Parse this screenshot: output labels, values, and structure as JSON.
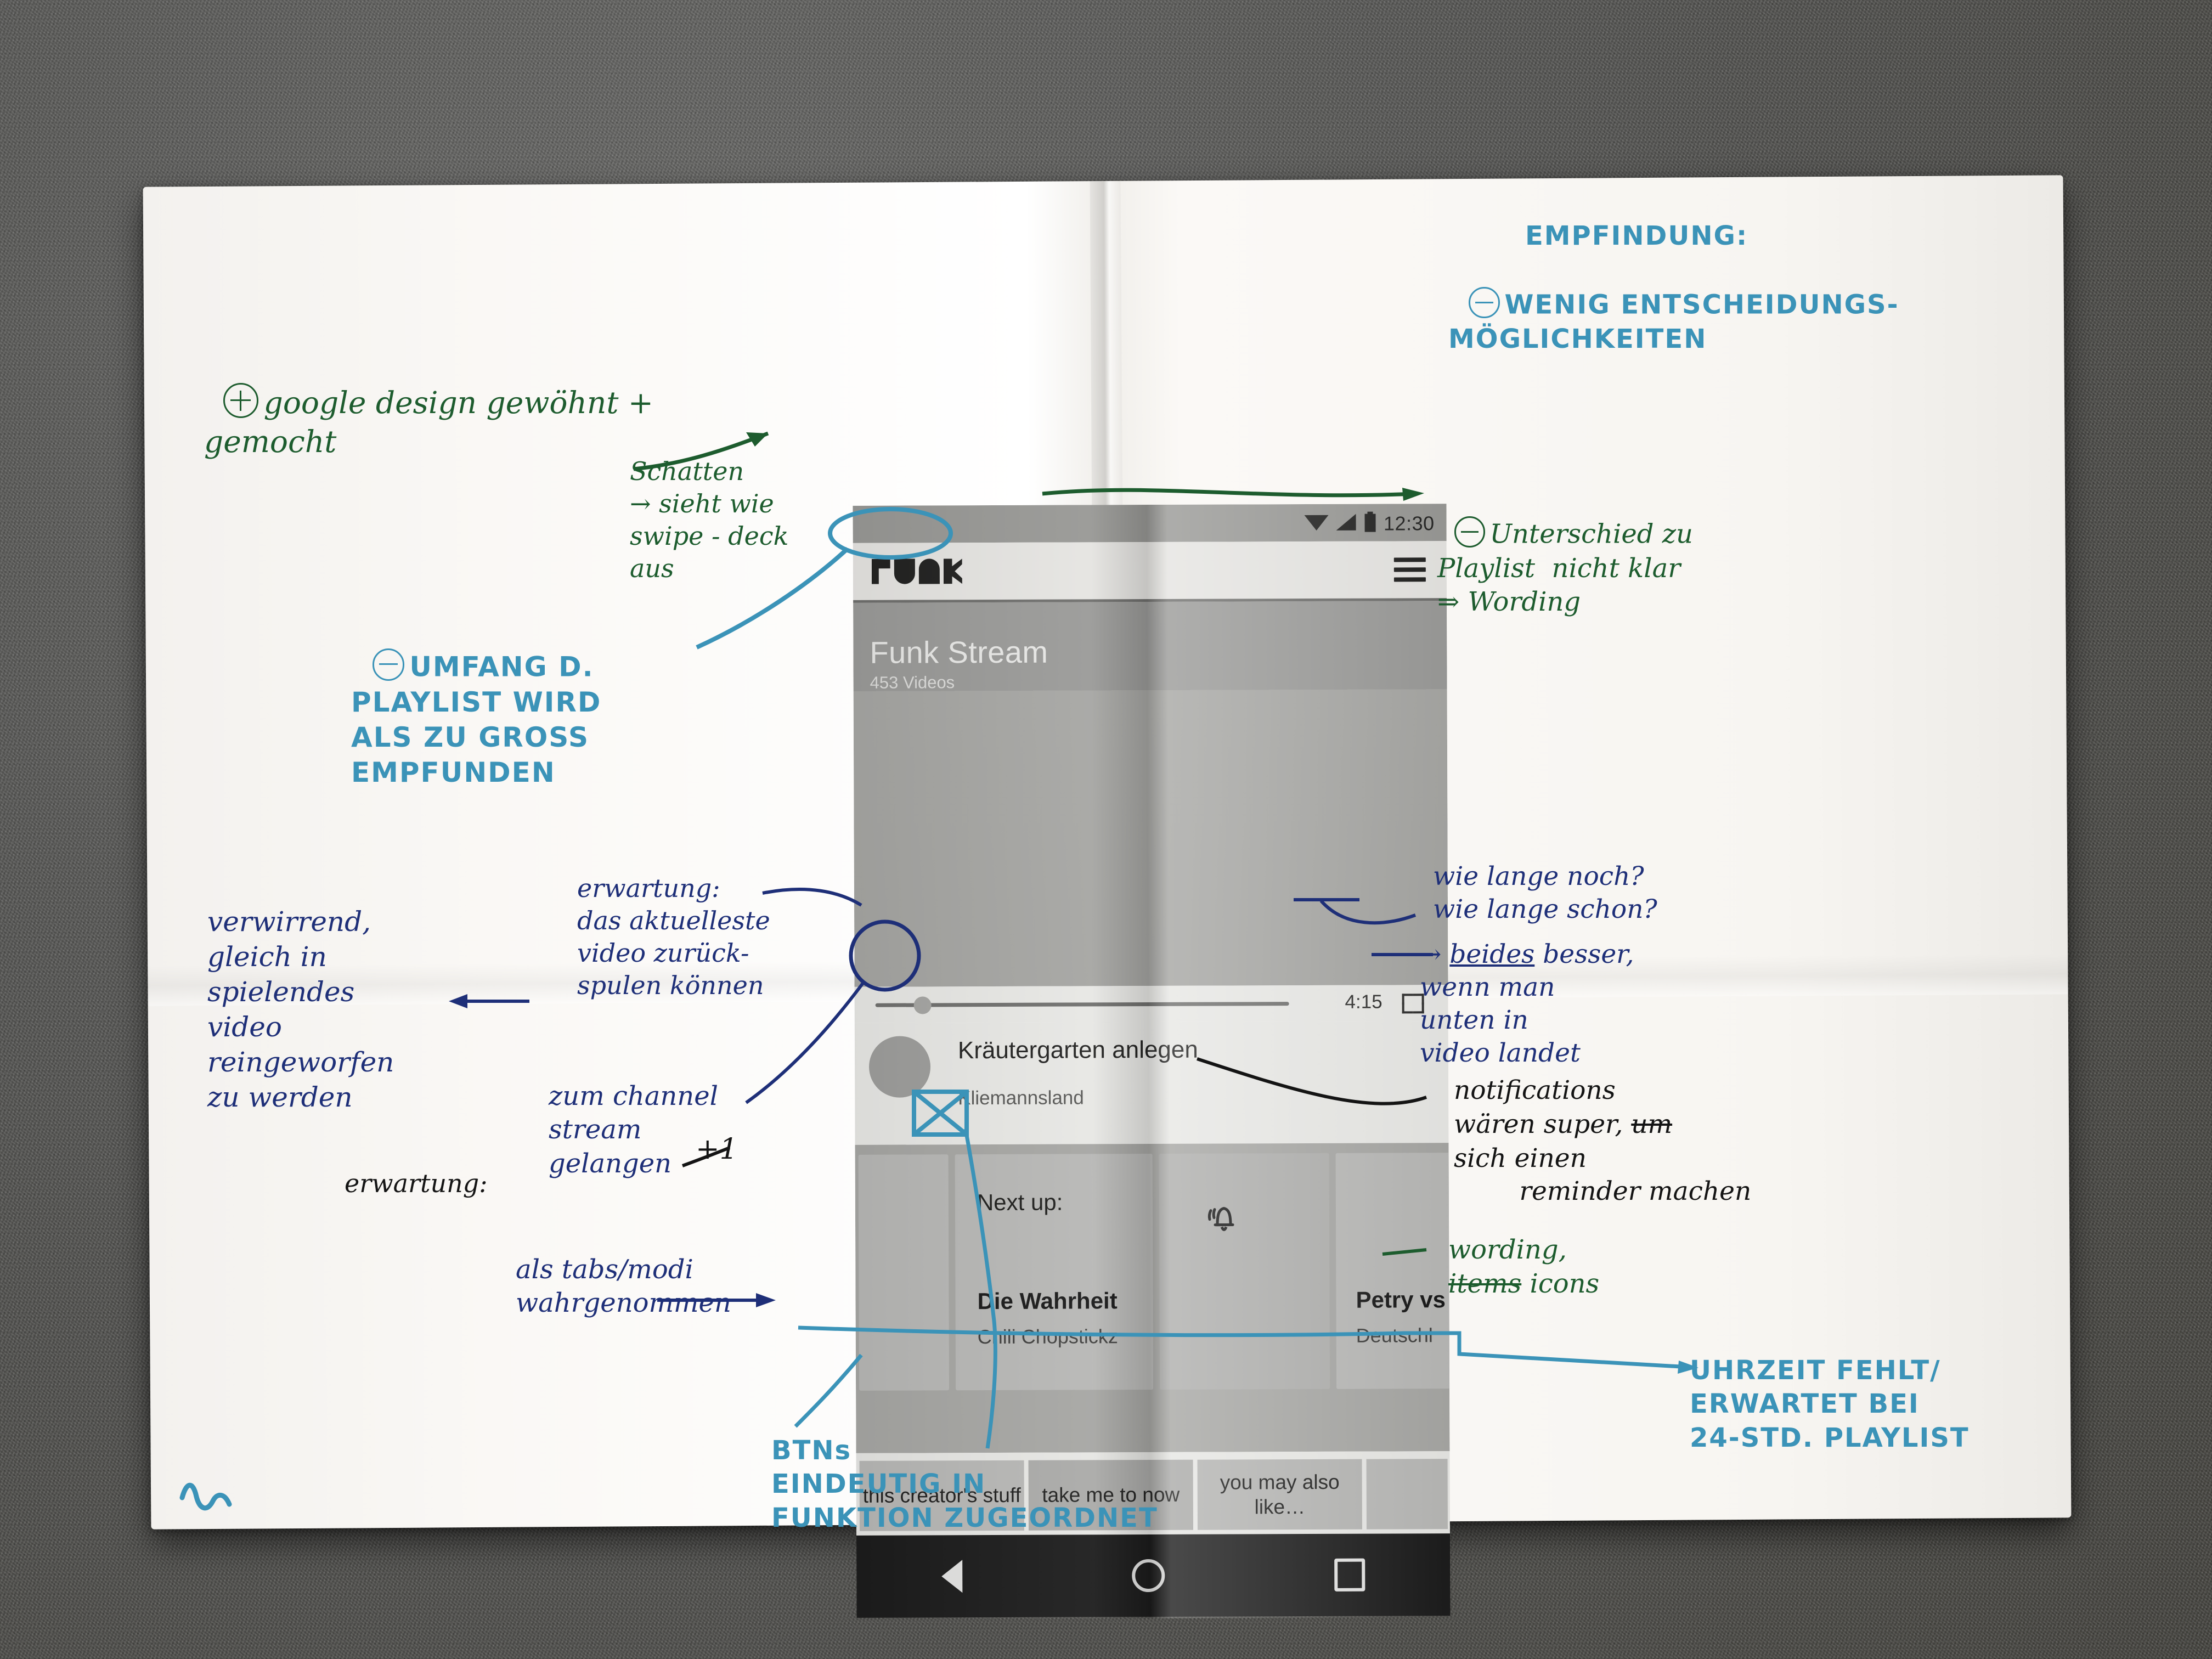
{
  "scene": {
    "medium": "photo of a folded A3 paper printout on grey carpet",
    "paper_note_bottom_left": "m"
  },
  "phone": {
    "statusbar": {
      "time": "12:30",
      "icons": [
        "wifi-icon",
        "signal-icon",
        "battery-icon"
      ]
    },
    "appbar": {
      "logo": "FUNK",
      "menu": "hamburger-menu-icon"
    },
    "hero": {
      "title": "Funk Stream",
      "subtitle": "453 Videos"
    },
    "player": {
      "duration": "4:15",
      "fullscreen": "fullscreen-icon",
      "progress_percent": 9
    },
    "now_playing": {
      "title": "Kräutergarten anlegen",
      "channel": "Kliemannsland"
    },
    "next_up_label": "Next up:",
    "cards": [
      {
        "title": "",
        "subtitle": ""
      },
      {
        "title": "Die Wahrheit",
        "subtitle": "Chili Chopstickz"
      },
      {
        "title": "",
        "subtitle": "",
        "icon": "bell-icon"
      },
      {
        "title": "Petry vs",
        "subtitle": "Deutschl"
      }
    ],
    "tabs": [
      "this creator's\nstuff",
      "take me to\nnow",
      "you may\nalso like…",
      ""
    ],
    "navbar": [
      "back-triangle-icon",
      "home-circle-icon",
      "recents-square-icon"
    ]
  },
  "annotations": {
    "a1": "google design gewöhnt +\ngemocht",
    "a2": "Schatten\n→ sieht wie\nswipe - deck\naus",
    "a3": "UMFANG D.\nPLAYLIST WIRD\nALS ZU GROSS\nEMPFUNDEN",
    "a4_title": "EMPFINDUNG:",
    "a4": "WENIG ENTSCHEIDUNGS-\nMÖGLICHKEITEN",
    "a5": "Unterschied zu\nPlaylist  nicht klar\n⇒ Wording",
    "a6": "verwirrend,\ngleich in\nspielendes\nvideo\nreingeworfen\nzu werden",
    "a7": "erwartung:\ndas aktuelleste\nvideo zurück-\nspulen können",
    "a8": "zum channel\nstream\ngelangen",
    "a8_plus": "+1",
    "a9": "erwartung:",
    "a10": "als tabs/modi\nwahrgenommen",
    "a11": "wie lange noch?\nwie lange schon?",
    "a11b_pre": "→ ",
    "a11b_u": "beides",
    "a11b_post": " besser,\nwenn man\nunten in\nvideo landet",
    "a12_l1": "notifications",
    "a12_l2_a": "wären super, ",
    "a12_l2_strike": "um",
    "a12_l3": "sich einen\n        reminder machen",
    "a13_l1": "wording,",
    "a13_strike": "items",
    "a13_l2": " icons",
    "a14": "UHRZEIT FEHLT/\nERWARTET BEI\n24-STD. PLAYLIST",
    "a15": "BTNs\nEINDEUTIG IN\nFUNKTION ZUGEORDNET"
  },
  "colors": {
    "green": "#1d5c2e",
    "teal": "#3b93b8",
    "navy": "#1e2f78",
    "black": "#141414",
    "paper": "#f7f5f1",
    "carpet": "#565654"
  }
}
